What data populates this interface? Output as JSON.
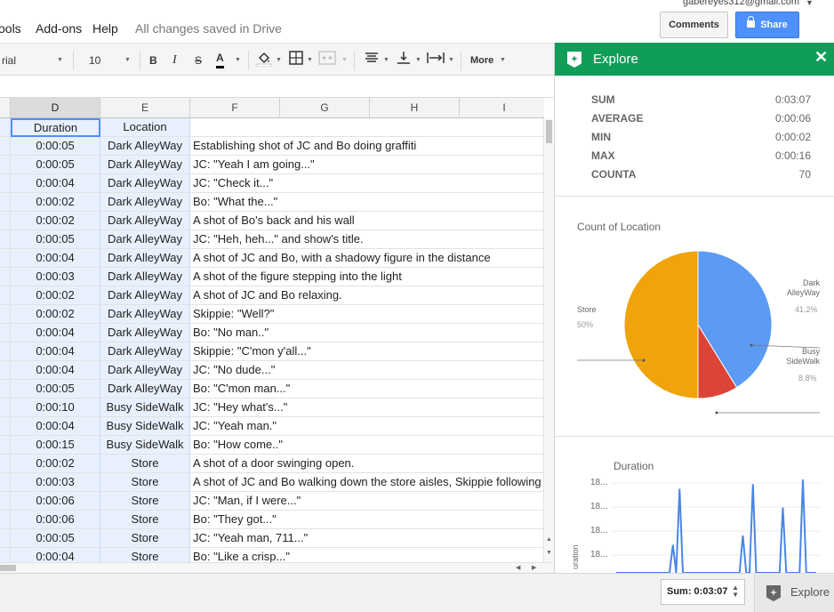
{
  "menubar": {
    "items": [
      "ools",
      "Add-ons",
      "Help"
    ],
    "saved_status": "All changes saved in Drive",
    "account": "gabereyes312@gmail.com",
    "comments_label": "Comments",
    "share_label": "Share"
  },
  "toolbar": {
    "font": "rial",
    "font_size": "10",
    "bold": "B",
    "italic": "I",
    "strike": "S",
    "text_color": "A",
    "more_label": "More"
  },
  "grid": {
    "columns": [
      "D",
      "E",
      "F",
      "G",
      "H",
      "I"
    ],
    "header_row": {
      "d": "Duration",
      "e": "Location",
      "f": ""
    },
    "rows": [
      {
        "d": "0:00:05",
        "e": "Dark AlleyWay",
        "f": "Establishing shot of JC and Bo doing graffiti"
      },
      {
        "d": "0:00:05",
        "e": "Dark AlleyWay",
        "f": "JC: \"Yeah I am going...\""
      },
      {
        "d": "0:00:04",
        "e": "Dark AlleyWay",
        "f": "JC: \"Check it...\""
      },
      {
        "d": "0:00:02",
        "e": "Dark AlleyWay",
        "f": "Bo: \"What the...\""
      },
      {
        "d": "0:00:02",
        "e": "Dark AlleyWay",
        "f": "A shot of Bo's back and his wall"
      },
      {
        "d": "0:00:05",
        "e": "Dark AlleyWay",
        "f": "JC: \"Heh, heh...\" and show's title."
      },
      {
        "d": "0:00:04",
        "e": "Dark AlleyWay",
        "f": "A shot of JC and Bo, with a shadowy figure in the distance"
      },
      {
        "d": "0:00:03",
        "e": "Dark AlleyWay",
        "f": "A shot of the figure stepping into the light"
      },
      {
        "d": "0:00:02",
        "e": "Dark AlleyWay",
        "f": "A shot of JC and Bo relaxing."
      },
      {
        "d": "0:00:02",
        "e": "Dark AlleyWay",
        "f": "Skippie: \"Well?\""
      },
      {
        "d": "0:00:04",
        "e": "Dark AlleyWay",
        "f": "Bo: \"No man..\""
      },
      {
        "d": "0:00:04",
        "e": "Dark AlleyWay",
        "f": "Skippie: \"C'mon y'all...\""
      },
      {
        "d": "0:00:04",
        "e": "Dark AlleyWay",
        "f": "JC: \"No dude...\""
      },
      {
        "d": "0:00:05",
        "e": "Dark AlleyWay",
        "f": "Bo: \"C'mon man...\""
      },
      {
        "d": "0:00:10",
        "e": "Busy SideWalk",
        "f": "JC: \"Hey what's...\""
      },
      {
        "d": "0:00:04",
        "e": "Busy SideWalk",
        "f": "JC: \"Yeah man.\""
      },
      {
        "d": "0:00:15",
        "e": "Busy SideWalk",
        "f": "Bo: \"How come..\""
      },
      {
        "d": "0:00:02",
        "e": "Store",
        "f": "A shot of a door swinging open."
      },
      {
        "d": "0:00:03",
        "e": "Store",
        "f": "A shot of JC and Bo walking down the store aisles, Skippie following"
      },
      {
        "d": "0:00:06",
        "e": "Store",
        "f": "JC: \"Man, if I were...\""
      },
      {
        "d": "0:00:06",
        "e": "Store",
        "f": "Bo: \"They got...\""
      },
      {
        "d": "0:00:05",
        "e": "Store",
        "f": "JC: \"Yeah man, 711...\""
      },
      {
        "d": "0:00:04",
        "e": "Store",
        "f": "Bo: \"Like a crisp...\""
      }
    ]
  },
  "bottom": {
    "sum_label": "Sum: 0:03:07",
    "explore_label": "Explore"
  },
  "explore": {
    "title": "Explore",
    "close": "✕",
    "stats": [
      {
        "label": "SUM",
        "value": "0:03:07"
      },
      {
        "label": "AVERAGE",
        "value": "0:00:06"
      },
      {
        "label": "MIN",
        "value": "0:00:02"
      },
      {
        "label": "MAX",
        "value": "0:00:16"
      },
      {
        "label": "COUNTA",
        "value": "70"
      }
    ],
    "pie_title": "Count of Location",
    "duration_title": "Duration",
    "duration_ylabel": "uration"
  },
  "chart_data": [
    {
      "type": "pie",
      "title": "Count of Location",
      "categories": [
        "Dark AlleyWay",
        "Busy SideWalk",
        "Store"
      ],
      "values": [
        41.2,
        8.8,
        50
      ],
      "labels": [
        "41.2%",
        "8.8%",
        "50%"
      ],
      "colors": [
        "#5b9bf3",
        "#db4437",
        "#f0a30a"
      ]
    },
    {
      "type": "line",
      "title": "Duration",
      "ylabel": "uration",
      "tick_labels": [
        "18...",
        "18...",
        "18...",
        "18..."
      ],
      "series": [
        {
          "values": [
            0,
            0,
            0,
            0,
            0,
            0,
            0,
            0,
            0,
            0,
            0,
            0,
            0,
            0,
            0,
            0,
            0,
            0.3,
            0,
            0.9,
            0,
            0,
            0,
            0,
            0,
            0,
            0,
            0,
            0,
            0,
            0,
            0,
            0,
            0,
            0,
            0,
            0,
            0,
            0.4,
            0,
            0,
            0.95,
            0,
            0,
            0,
            0,
            0,
            0,
            0,
            0,
            0.7,
            0,
            0,
            0,
            0,
            0,
            1,
            0,
            0,
            0,
            0
          ],
          "color": "#4a86e8"
        }
      ]
    }
  ]
}
